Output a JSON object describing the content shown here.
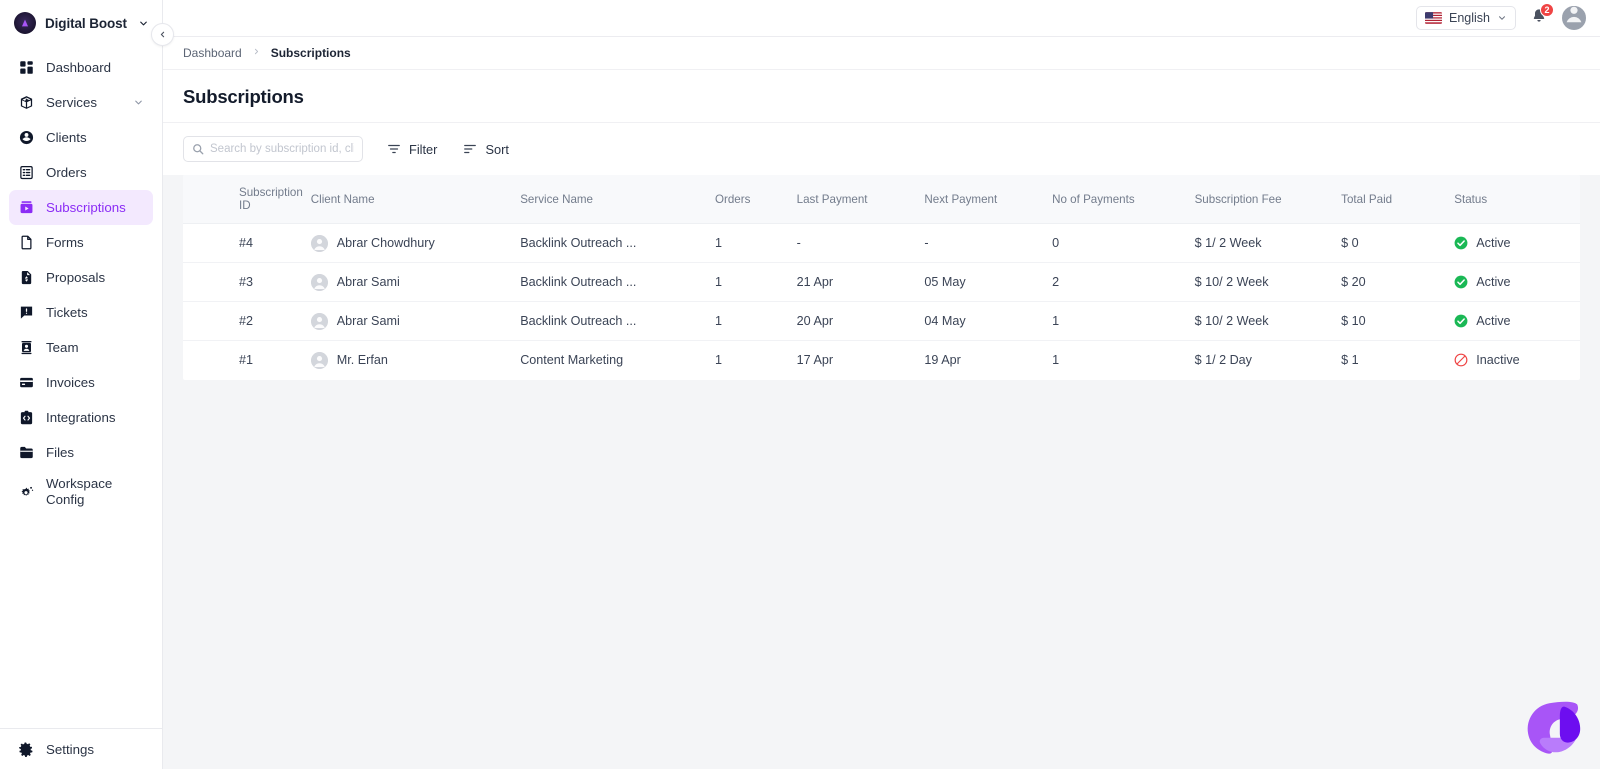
{
  "brand": {
    "name": "Digital Boost",
    "logo_icon": "triangle-logo-icon",
    "caret_icon": "chevron-down-icon",
    "collapse_icon": "chevron-left-icon"
  },
  "sidebar": {
    "items": [
      {
        "label": "Dashboard",
        "icon": "dashboard-grid-icon",
        "active": false,
        "expandable": false
      },
      {
        "label": "Services",
        "icon": "box-icon",
        "active": false,
        "expandable": true
      },
      {
        "label": "Clients",
        "icon": "users-circle-icon",
        "active": false,
        "expandable": false
      },
      {
        "label": "Orders",
        "icon": "list-table-icon",
        "active": false,
        "expandable": false
      },
      {
        "label": "Subscriptions",
        "icon": "subscriptions-icon",
        "active": true,
        "expandable": false
      },
      {
        "label": "Forms",
        "icon": "document-icon",
        "active": false,
        "expandable": false
      },
      {
        "label": "Proposals",
        "icon": "proposal-doc-icon",
        "active": false,
        "expandable": false
      },
      {
        "label": "Tickets",
        "icon": "ticket-alert-icon",
        "active": false,
        "expandable": false
      },
      {
        "label": "Team",
        "icon": "team-person-icon",
        "active": false,
        "expandable": false
      },
      {
        "label": "Invoices",
        "icon": "card-invoice-icon",
        "active": false,
        "expandable": false
      },
      {
        "label": "Integrations",
        "icon": "integrations-icon",
        "active": false,
        "expandable": false
      },
      {
        "label": "Files",
        "icon": "folder-icon",
        "active": false,
        "expandable": false
      },
      {
        "label": "Workspace Config",
        "icon": "gear-config-icon",
        "active": false,
        "expandable": false
      }
    ],
    "settings": {
      "label": "Settings",
      "icon": "gear-icon"
    }
  },
  "topbar": {
    "language": "English",
    "language_flag": "us-flag-icon",
    "language_caret_icon": "chevron-down-icon",
    "notification_icon": "bell-icon",
    "notification_count": "2",
    "avatar_icon": "user-avatar-icon"
  },
  "breadcrumb": {
    "parent": "Dashboard",
    "separator": "›",
    "current": "Subscriptions"
  },
  "page": {
    "title": "Subscriptions"
  },
  "toolbar": {
    "search_placeholder": "Search by subscription id, client",
    "search_value": "",
    "search_icon": "search-icon",
    "filter_label": "Filter",
    "filter_icon": "filter-icon",
    "sort_label": "Sort",
    "sort_icon": "sort-icon"
  },
  "table": {
    "columns": [
      "Subscription ID",
      "Client Name",
      "Service Name",
      "Orders",
      "Last Payment",
      "Next Payment",
      "No of Payments",
      "Subscription Fee",
      "Total Paid",
      "Status"
    ],
    "rows": [
      {
        "id": "#4",
        "client": "Abrar Chowdhury",
        "service": "Backlink Outreach ...",
        "orders": "1",
        "last_payment": "-",
        "next_payment": "-",
        "no_of_payments": "0",
        "fee": "$ 1/ 2 Week",
        "total_paid": "$ 0",
        "status": "Active"
      },
      {
        "id": "#3",
        "client": "Abrar Sami",
        "service": "Backlink Outreach ...",
        "orders": "1",
        "last_payment": "21 Apr",
        "next_payment": "05 May",
        "no_of_payments": "2",
        "fee": "$ 10/ 2 Week",
        "total_paid": "$ 20",
        "status": "Active"
      },
      {
        "id": "#2",
        "client": "Abrar Sami",
        "service": "Backlink Outreach ...",
        "orders": "1",
        "last_payment": "20 Apr",
        "next_payment": "04 May",
        "no_of_payments": "1",
        "fee": "$ 10/ 2 Week",
        "total_paid": "$ 10",
        "status": "Active"
      },
      {
        "id": "#1",
        "client": "Mr. Erfan",
        "service": "Content Marketing",
        "orders": "1",
        "last_payment": "17 Apr",
        "next_payment": "19 Apr",
        "no_of_payments": "1",
        "fee": "$ 1/ 2 Day",
        "total_paid": "$ 1",
        "status": "Inactive"
      }
    ]
  },
  "fab": {
    "icon": "chat-widget-logo-icon"
  },
  "colors": {
    "accent": "#8b2cf5",
    "accent_bg": "#f3e9fe",
    "status_active": "#22bb55",
    "status_inactive": "#ef4444",
    "badge": "#ef4444",
    "page_bg": "#f4f5f7",
    "text": "#3b4456"
  }
}
